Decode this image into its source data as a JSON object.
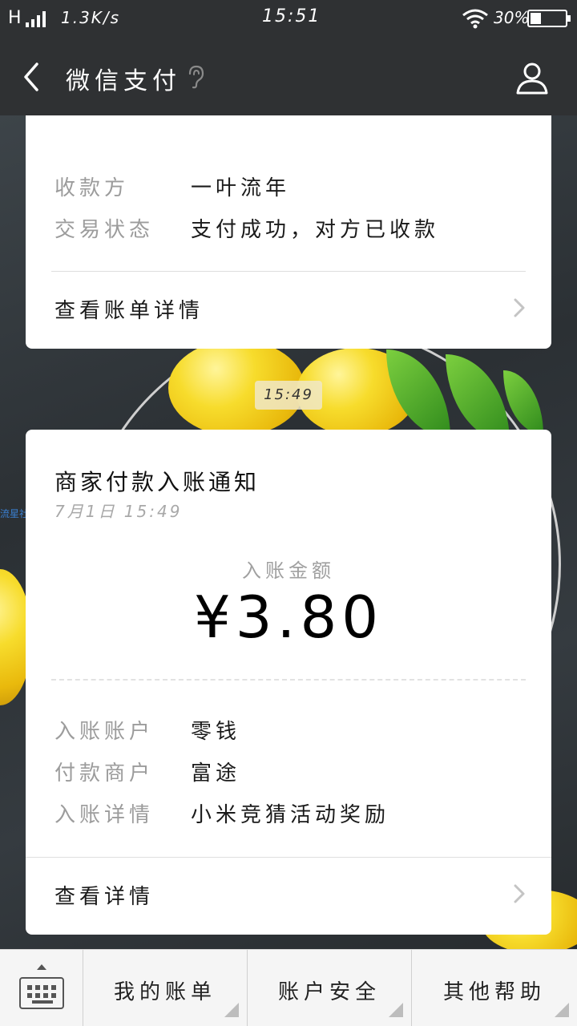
{
  "status_bar": {
    "signal": "H",
    "net_speed": "1.3K/s",
    "time": "15:51",
    "battery": "30%",
    "battery_level": 0.3
  },
  "title_bar": {
    "title": "微信支付",
    "back_icon": "chevron-left-icon",
    "ear_icon": "ear-icon",
    "profile_icon": "person-icon"
  },
  "card1": {
    "rows": [
      {
        "key": "收款方",
        "value": "一叶流年"
      },
      {
        "key": "交易状态",
        "value": "支付成功，对方已收款"
      }
    ],
    "link": "查看账单详情"
  },
  "timestamp_chip": "15:49",
  "card2": {
    "title": "商家付款入账通知",
    "time": "7月1日 15:49",
    "amount_label": "入账金额",
    "amount": "¥3.80",
    "rows": [
      {
        "key": "入账账户",
        "value": "零钱"
      },
      {
        "key": "付款商户",
        "value": "富途"
      },
      {
        "key": "入账详情",
        "value": "小米竞猜活动奖励"
      }
    ],
    "link": "查看详情"
  },
  "watermark": "流星社区",
  "menu": {
    "keyboard_icon": "keyboard-icon",
    "items": [
      {
        "label": "我的账单"
      },
      {
        "label": "账户安全"
      },
      {
        "label": "其他帮助"
      }
    ]
  },
  "colors": {
    "header_bg": "#2f3133",
    "card_bg": "#ffffff",
    "key_text": "#9c9c9c",
    "value_text": "#1a1a1a"
  }
}
